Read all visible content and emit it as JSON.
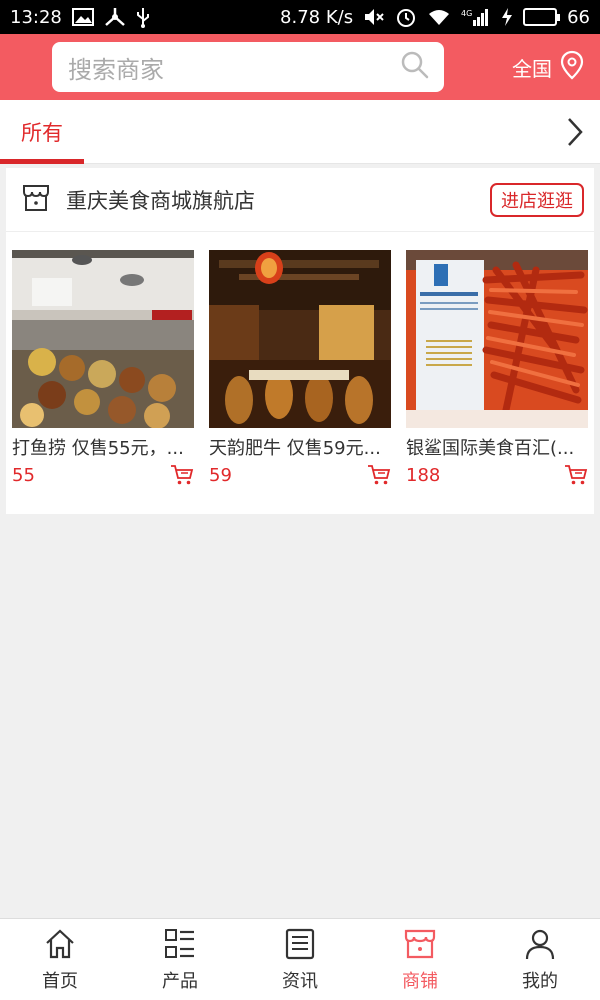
{
  "statusbar": {
    "time": "13:28",
    "speed": "8.78 K/s",
    "network": "4G",
    "battery": "66",
    "battery_fraction": 0.66
  },
  "header": {
    "search_placeholder": "搜索商家",
    "region": "全国"
  },
  "tabs": {
    "all": "所有"
  },
  "store": {
    "name": "重庆美食商城旗航店",
    "enter_button": "进店逛逛",
    "products": [
      {
        "title": "打鱼捞 仅售55元，...",
        "price": "55",
        "image": "buffet-food-photo"
      },
      {
        "title": "天韵肥牛 仅售59元...",
        "price": "59",
        "image": "restaurant-interior-photo"
      },
      {
        "title": "银鲨国际美食百汇(...",
        "price": "188",
        "image": "king-crab-legs-photo"
      }
    ]
  },
  "bottom_nav": [
    {
      "label": "首页",
      "icon": "home-icon"
    },
    {
      "label": "产品",
      "icon": "list-icon"
    },
    {
      "label": "资讯",
      "icon": "news-icon"
    },
    {
      "label": "商铺",
      "icon": "store-icon",
      "active": true
    },
    {
      "label": "我的",
      "icon": "profile-icon"
    }
  ],
  "colors": {
    "accent": "#f35b61",
    "price": "#e1292b",
    "active_tab": "#d9272a"
  }
}
